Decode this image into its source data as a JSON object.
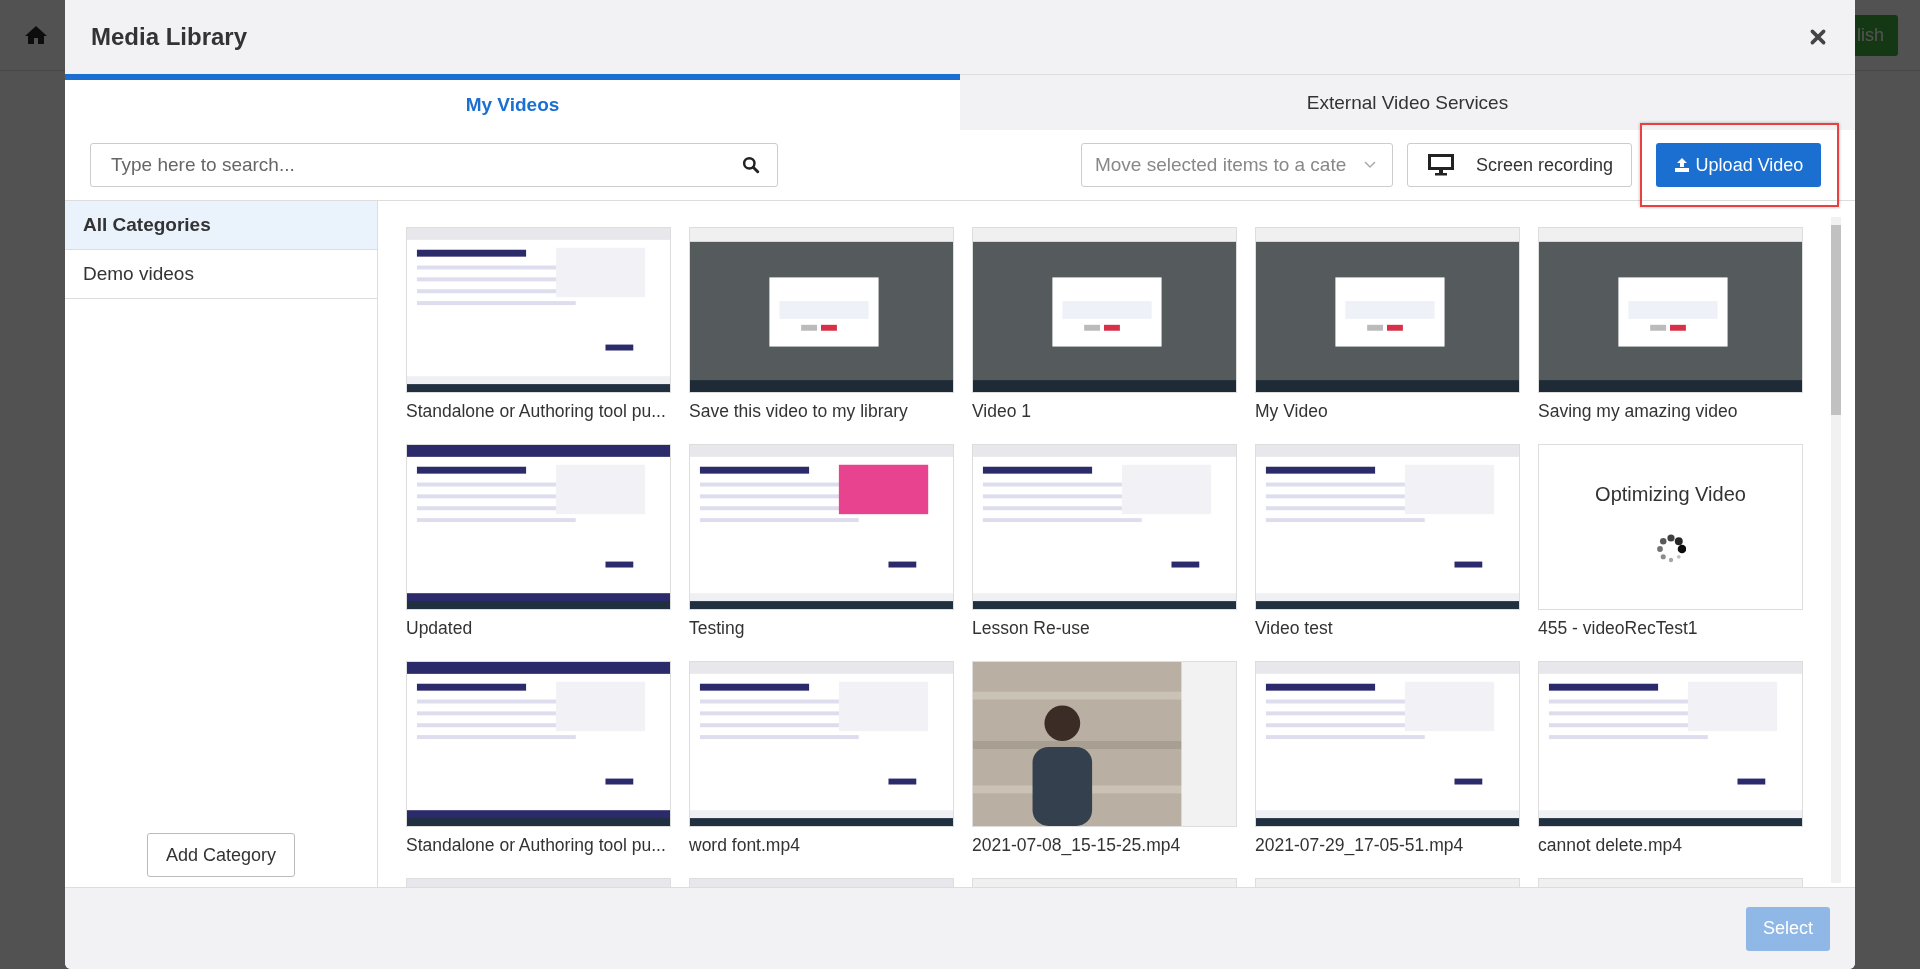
{
  "background": {
    "publish_button": "lish"
  },
  "window": {
    "title": "Media Library"
  },
  "tabs": [
    {
      "label": "My Videos",
      "selected": true
    },
    {
      "label": "External Video Services",
      "selected": false
    }
  ],
  "search": {
    "placeholder": "Type here to search..."
  },
  "category_select": {
    "placeholder": "Move selected items to a cate"
  },
  "screen_recording_button": "Screen recording",
  "upload_button": {
    "label": "Upload Video",
    "highlighted": true
  },
  "categories": [
    {
      "label": "All Categories",
      "selected": true
    },
    {
      "label": "Demo videos",
      "selected": false
    }
  ],
  "add_category_button": "Add Category",
  "videos": [
    {
      "kind": "picture",
      "title": "Standalone or Authoring tool pu..."
    },
    {
      "kind": "picture",
      "title": "Save this video to my library"
    },
    {
      "kind": "picture",
      "title": "Video 1"
    },
    {
      "kind": "picture",
      "title": "My Video"
    },
    {
      "kind": "picture",
      "title": "Saving my amazing video"
    },
    {
      "kind": "picture",
      "title": "Updated"
    },
    {
      "kind": "picture",
      "title": "Testing"
    },
    {
      "kind": "picture",
      "title": "Lesson Re-use"
    },
    {
      "kind": "picture",
      "title": "Video test"
    },
    {
      "kind": "processing",
      "status": "Optimizing Video",
      "title": "455 - videoRecTest1"
    },
    {
      "kind": "picture",
      "title": "Standalone or Authoring tool pu..."
    },
    {
      "kind": "picture",
      "title": "word font.mp4"
    },
    {
      "kind": "picture",
      "title": "2021-07-08_15-15-25.mp4"
    },
    {
      "kind": "picture",
      "title": "2021-07-29_17-05-51.mp4"
    },
    {
      "kind": "picture",
      "title": "cannot delete.mp4"
    },
    {
      "kind": "picture"
    },
    {
      "kind": "picture"
    },
    {
      "kind": "picture"
    },
    {
      "kind": "picture"
    },
    {
      "kind": "picture"
    }
  ],
  "footer": {
    "select_button": {
      "label": "Select",
      "disabled": true
    }
  }
}
